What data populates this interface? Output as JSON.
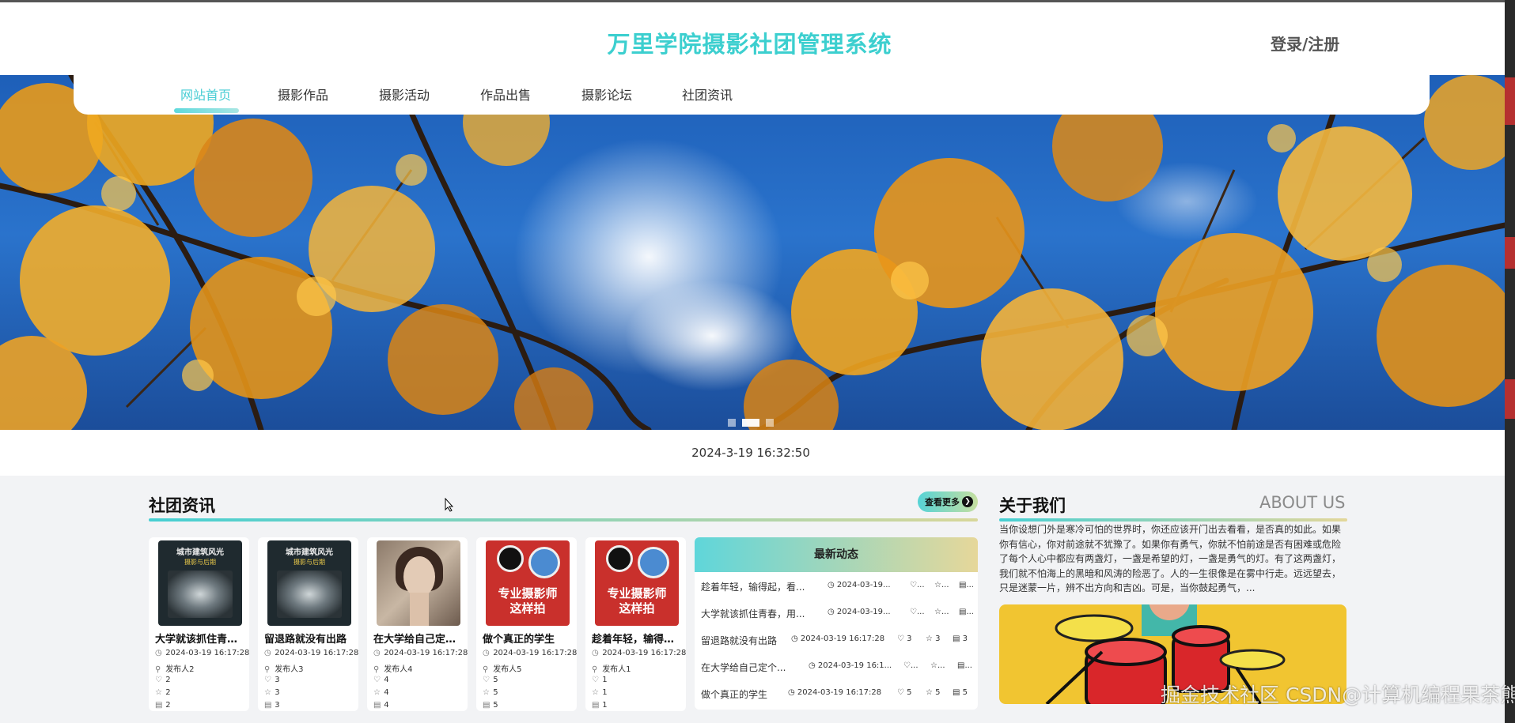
{
  "header": {
    "site_title": "万里学院摄影社团管理系统",
    "login_label": "登录/注册"
  },
  "nav": {
    "items": [
      {
        "label": "网站首页",
        "active": true
      },
      {
        "label": "摄影作品",
        "active": false
      },
      {
        "label": "摄影活动",
        "active": false
      },
      {
        "label": "作品出售",
        "active": false
      },
      {
        "label": "摄影论坛",
        "active": false
      },
      {
        "label": "社团资讯",
        "active": false
      }
    ]
  },
  "banner": {
    "slide_count": 3,
    "active_slide": 2
  },
  "datetime": "2024-3-19 16:32:50",
  "club_news": {
    "title": "社团资讯",
    "more_label": "查看更多",
    "cards": [
      {
        "title": "大学就该抓住青春，用...",
        "date": "2024-03-19 16:17:28",
        "publisher": "发布人2",
        "likes": "2",
        "favorites": "2",
        "views": "2",
        "cover_title": "城市建筑风光",
        "cover_subtitle": "摄影与后期"
      },
      {
        "title": "留退路就没有出路",
        "date": "2024-03-19 16:17:28",
        "publisher": "发布人3",
        "likes": "3",
        "favorites": "3",
        "views": "3",
        "cover_title": "城市建筑风光",
        "cover_subtitle": "摄影与后期"
      },
      {
        "title": "在大学给自己定个目标",
        "date": "2024-03-19 16:17:28",
        "publisher": "发布人4",
        "likes": "4",
        "favorites": "4",
        "views": "4"
      },
      {
        "title": "做个真正的学生",
        "date": "2024-03-19 16:17:28",
        "publisher": "发布人5",
        "likes": "5",
        "favorites": "5",
        "views": "5",
        "cover_title": "专业摄影师\n这样拍"
      },
      {
        "title": "趁着年轻，输得起，看...",
        "date": "2024-03-19 16:17:28",
        "publisher": "发布人1",
        "likes": "1",
        "favorites": "1",
        "views": "1",
        "cover_title": "专业摄影师\n这样拍"
      }
    ]
  },
  "latest": {
    "title": "最新动态",
    "rows": [
      {
        "title": "趁着年轻，输得起，看...",
        "date": "2024-03-19...",
        "likes": "...",
        "favorites": "...",
        "views": "..."
      },
      {
        "title": "大学就该抓住青春，用...",
        "date": "2024-03-19...",
        "likes": "...",
        "favorites": "...",
        "views": "..."
      },
      {
        "title": "留退路就没有出路",
        "date": "2024-03-19 16:17:28",
        "likes": "3",
        "favorites": "3",
        "views": "3"
      },
      {
        "title": "在大学给自己定个...",
        "date": "2024-03-19 16:1...",
        "likes": "...",
        "favorites": "...",
        "views": "..."
      },
      {
        "title": "做个真正的学生",
        "date": "2024-03-19 16:17:28",
        "likes": "5",
        "favorites": "5",
        "views": "5"
      }
    ]
  },
  "about": {
    "title": "关于我们",
    "title_en": "ABOUT US",
    "text": "当你设想门外是寒冷可怕的世界时，你还应该开门出去看看，是否真的如此。如果你有信心，你对前途就不犹豫了。如果你有勇气，你就不怕前途是否有困难或危险了每个人心中都应有两盏灯，一盏是希望的灯，一盏是勇气的灯。有了这两盏灯，我们就不怕海上的黑暗和风涛的险恶了。人的一生很像是在雾中行走。远远望去，只是迷蒙一片，辨不出方向和吉凶。可是，当你鼓起勇气，..."
  },
  "watermark": "CSDN@计算机编程果茶熊",
  "watermark_overlay": "掘金技术社区",
  "colors": {
    "accent": "#48cdd4",
    "title": "#3ccfcf",
    "about_img_bg": "#f1c531"
  }
}
